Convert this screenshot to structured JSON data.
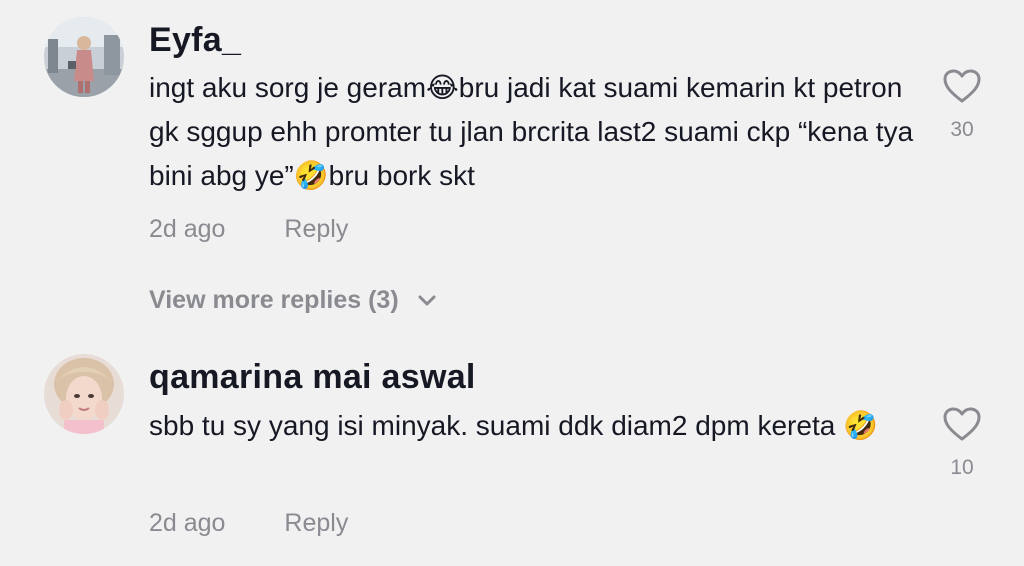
{
  "comments": [
    {
      "username": "Eyfa_",
      "text": "ingt aku sorg je geram😂bru jadi kat suami kemarin kt petron gk sggup ehh promter tu jlan brcrita last2 suami ckp “kena tya bini abg ye”🤣bru bork skt",
      "time": "2d ago",
      "reply_label": "Reply",
      "likes": "30",
      "like_icon": "heart-outline-icon"
    },
    {
      "username": "qamarina mai aswal",
      "text": "sbb tu sy yang isi minyak. suami ddk diam2 dpm kereta 🤣",
      "time": "2d ago",
      "reply_label": "Reply",
      "likes": "10",
      "like_icon": "heart-outline-icon"
    }
  ],
  "view_more_replies": "View more replies (3)",
  "colors": {
    "background": "#f1f1f2",
    "text_primary": "#161823",
    "text_secondary": "#8a8b91"
  }
}
